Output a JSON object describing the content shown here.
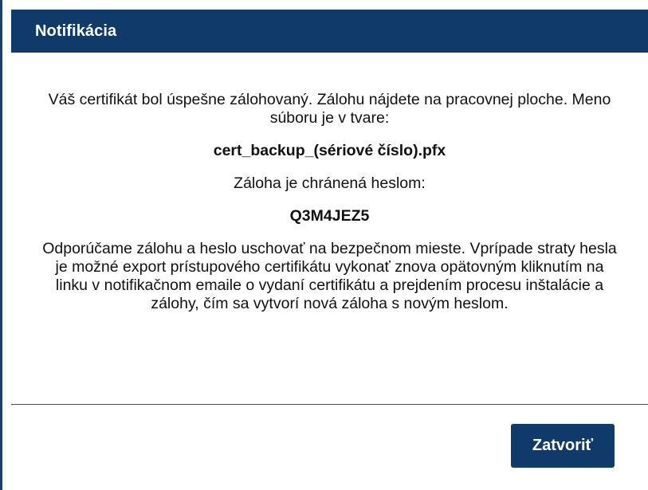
{
  "dialog": {
    "title": "Notifikácia",
    "message": {
      "intro": "Váš certifikát bol úspešne zálohovaný. Zálohu nájdete na pracovnej ploche. Meno súboru je v tvare:",
      "filename": "cert_backup_(sériové číslo).pfx",
      "password_label": "Záloha je chránená heslom:",
      "password_value": "Q3M4JEZ5",
      "recommendation": "Odporúčame zálohu a heslo uschovať na bezpečnom mieste. Vprípade straty hesla je možné export prístupového certifikátu vykonať znova opätovným kliknutím na linku v notifikačnom emaile o vydaní certifikátu a prejdením procesu inštalácie a zálohy, čím sa vytvorí nová záloha s novým heslom."
    },
    "buttons": {
      "close_label": "Zatvoriť"
    }
  },
  "colors": {
    "header_background": "#0f3a69",
    "button_background": "#0f3a69",
    "header_text": "#ffffff",
    "body_text": "#111111"
  }
}
